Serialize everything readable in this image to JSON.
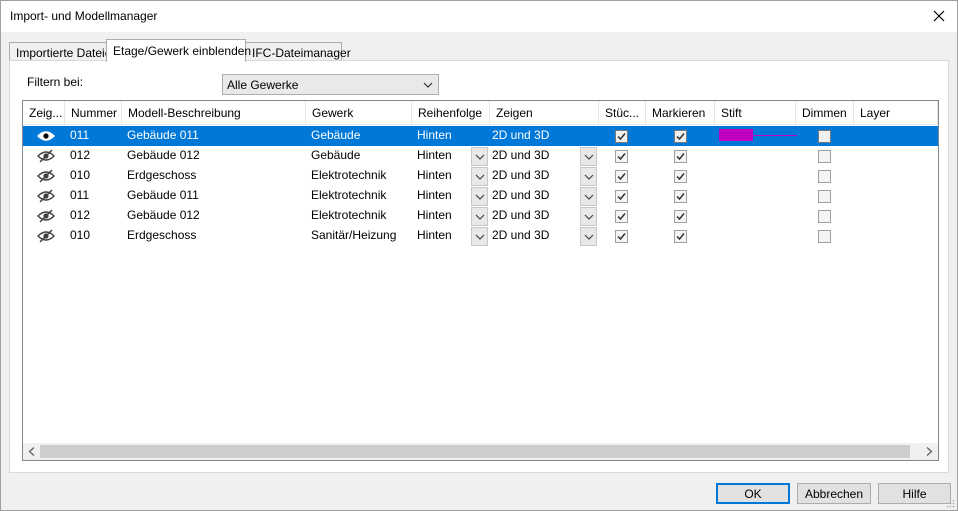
{
  "window": {
    "title": "Import- und Modellmanager"
  },
  "tabs": [
    {
      "label": "Importierte Dateien",
      "active": false
    },
    {
      "label": "Etage/Gewerk einblenden",
      "active": true
    },
    {
      "label": "IFC-Dateimanager",
      "active": false
    }
  ],
  "filter": {
    "label": "Filtern bei:",
    "value": "Alle Gewerke"
  },
  "columns": [
    "Zeig...",
    "Nummer",
    "Modell-Beschreibung",
    "Gewerk",
    "Reihenfolge",
    "Zeigen",
    "Stüc...",
    "Markieren",
    "Stift",
    "Dimmen",
    "Layer"
  ],
  "rows": [
    {
      "visible": true,
      "nummer": "011",
      "beschreibung": "Gebäude 011",
      "gewerk": "Gebäude",
      "reihenfolge": "Hinten",
      "zeigen": "2D und 3D",
      "stueck": true,
      "markieren": true,
      "stift": "#c000c0",
      "dimmen": false,
      "selected": true
    },
    {
      "visible": false,
      "nummer": "012",
      "beschreibung": "Gebäude 012",
      "gewerk": "Gebäude",
      "reihenfolge": "Hinten",
      "zeigen": "2D und 3D",
      "stueck": true,
      "markieren": true,
      "stift": "",
      "dimmen": false,
      "selected": false
    },
    {
      "visible": false,
      "nummer": "010",
      "beschreibung": "Erdgeschoss",
      "gewerk": "Elektrotechnik",
      "reihenfolge": "Hinten",
      "zeigen": "2D und 3D",
      "stueck": true,
      "markieren": true,
      "stift": "",
      "dimmen": false,
      "selected": false
    },
    {
      "visible": false,
      "nummer": "011",
      "beschreibung": "Gebäude 011",
      "gewerk": "Elektrotechnik",
      "reihenfolge": "Hinten",
      "zeigen": "2D und 3D",
      "stueck": true,
      "markieren": true,
      "stift": "",
      "dimmen": false,
      "selected": false
    },
    {
      "visible": false,
      "nummer": "012",
      "beschreibung": "Gebäude 012",
      "gewerk": "Elektrotechnik",
      "reihenfolge": "Hinten",
      "zeigen": "2D und 3D",
      "stueck": true,
      "markieren": true,
      "stift": "",
      "dimmen": false,
      "selected": false
    },
    {
      "visible": false,
      "nummer": "010",
      "beschreibung": "Erdgeschoss",
      "gewerk": "Sanitär/Heizung",
      "reihenfolge": "Hinten",
      "zeigen": "2D und 3D",
      "stueck": true,
      "markieren": true,
      "stift": "",
      "dimmen": false,
      "selected": false
    }
  ],
  "buttons": {
    "ok": "OK",
    "cancel": "Abbrechen",
    "help": "Hilfe"
  },
  "colors": {
    "selection": "#0078d7",
    "pen": "#c000c0"
  },
  "icons": {
    "visible": "eye-icon",
    "hidden": "eye-off-icon",
    "close": "close-icon"
  }
}
